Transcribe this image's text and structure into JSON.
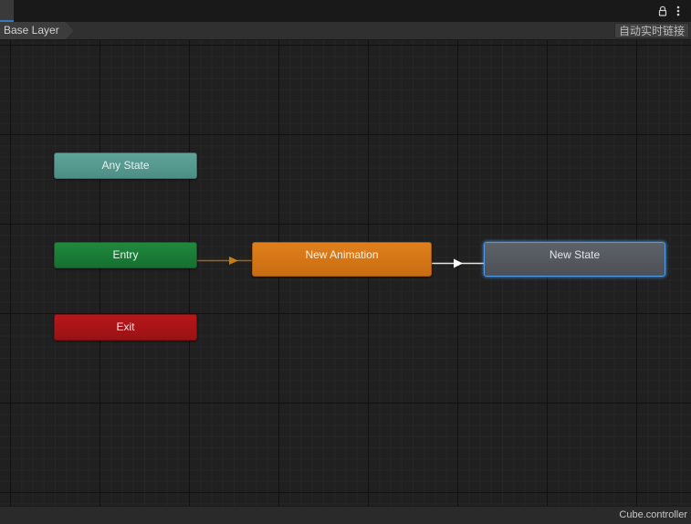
{
  "toolbar": {
    "lock_icon": "lock-icon",
    "menu_icon": "vertical-ellipsis-icon"
  },
  "breadcrumb": {
    "layer": "Base Layer"
  },
  "live_link_button": "自动实时链接",
  "graph": {
    "states": {
      "any_state": "Any State",
      "entry": "Entry",
      "exit": "Exit",
      "new_animation": "New Animation",
      "new_state": "New State"
    },
    "colors": {
      "any_state": "#4d8e84",
      "entry": "#176f30",
      "exit": "#991215",
      "new_animation": "#c86d12",
      "new_state": "#4d5157",
      "selection": "#4f9ce8",
      "default_transition": "#a0640f",
      "transition": "#e6e6e6"
    }
  },
  "status": {
    "file": "Cube.controller"
  }
}
